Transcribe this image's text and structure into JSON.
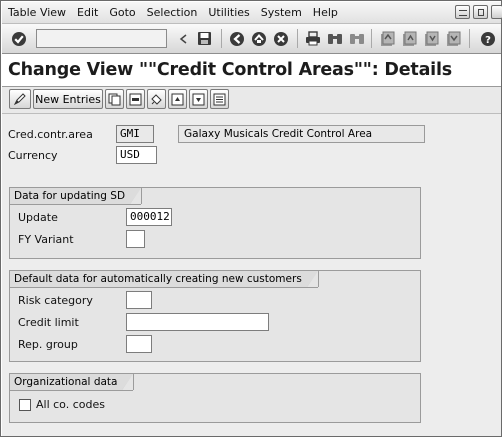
{
  "menu": {
    "items": [
      "Table View",
      "Edit",
      "Goto",
      "Selection",
      "Utilities",
      "System",
      "Help"
    ]
  },
  "toolbar": {
    "command_field": "",
    "icons": [
      "enter-icon",
      "command-field-arrow-icon",
      "save-icon",
      "back-icon",
      "exit-icon",
      "cancel-icon",
      "print-icon",
      "find-icon",
      "find-next-icon",
      "first-page-icon",
      "previous-page-icon",
      "next-page-icon",
      "last-page-icon",
      "help-icon"
    ]
  },
  "page": {
    "title": "Change View \"\"Credit Control Areas\"\": Details"
  },
  "app_toolbar": {
    "new_entries_label": "New Entries",
    "icons": [
      "display-change-icon",
      "copy-as-icon",
      "delete-icon",
      "undo-change-icon",
      "previous-entry-icon",
      "next-entry-icon",
      "select-all-icon"
    ]
  },
  "header": {
    "credit_control_area_label": "Cred.contr.area",
    "credit_control_area_value": "GMI",
    "credit_control_area_desc": "Galaxy Musicals Credit Control Area",
    "currency_label": "Currency",
    "currency_value": "USD"
  },
  "groups": {
    "sd": {
      "title": "Data for updating SD",
      "update_label": "Update",
      "update_value": "000012",
      "fy_variant_label": "FY Variant",
      "fy_variant_value": ""
    },
    "defaults": {
      "title": "Default data for automatically creating new customers",
      "risk_category_label": "Risk category",
      "risk_category_value": "",
      "credit_limit_label": "Credit limit",
      "credit_limit_value": "",
      "rep_group_label": "Rep. group",
      "rep_group_value": ""
    },
    "org": {
      "title": "Organizational data",
      "all_co_codes_label": "All co. codes",
      "all_co_codes_checked": false
    }
  }
}
